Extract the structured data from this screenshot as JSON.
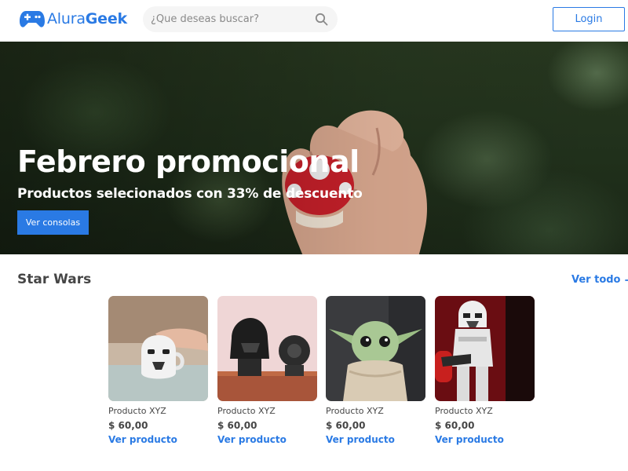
{
  "header": {
    "logo": {
      "prefix": "Alura",
      "suffix": "Geek",
      "icon": "gamepad-icon"
    },
    "search": {
      "placeholder": "¿Que deseas buscar?",
      "icon": "search-icon"
    },
    "login_label": "Login"
  },
  "hero": {
    "title": "Febrero promocional",
    "subtitle": "Productos selecionados con 33% de descuento",
    "button_label": "Ver consolas"
  },
  "section": {
    "title": "Star Wars",
    "see_all_label": "Ver todo",
    "see_all_icon": "arrow-right-icon",
    "products": [
      {
        "name": "Producto XYZ",
        "price": "$ 60,00",
        "link_label": "Ver producto"
      },
      {
        "name": "Producto XYZ",
        "price": "$ 60,00",
        "link_label": "Ver producto"
      },
      {
        "name": "Producto XYZ",
        "price": "$ 60,00",
        "link_label": "Ver producto"
      },
      {
        "name": "Producto XYZ",
        "price": "$ 60,00",
        "link_label": "Ver producto"
      }
    ]
  },
  "colors": {
    "accent": "#2a7ae4",
    "text": "#464646",
    "search_bg": "#f5f5f5"
  }
}
